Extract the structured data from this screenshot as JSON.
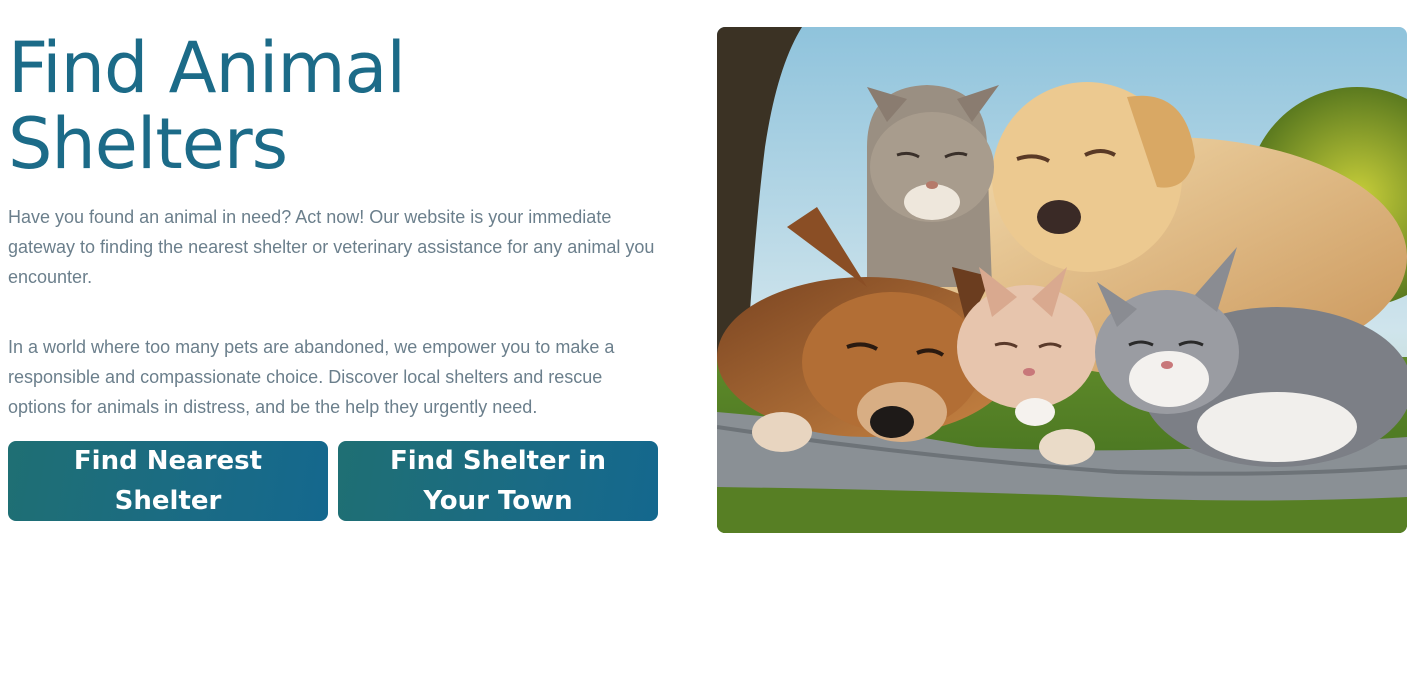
{
  "hero": {
    "title_line1": "Find Animal",
    "title_line2": "Shelters",
    "paragraph1": "Have you found an animal in need? Act now! Our website is your immediate gateway to finding the nearest shelter or veterinary assistance for any animal you encounter.",
    "paragraph2": "In a world where too many pets are abandoned, we empower you to make a responsible and compassionate choice. Discover local shelters and rescue options for animals in distress, and be the help they urgently need.",
    "buttons": {
      "nearest_label": "Find Nearest Shelter",
      "town_label": "Find Shelter in Your Town"
    }
  },
  "image": {
    "subject": "dogs and cats sleeping together on a blanket in the grass"
  },
  "colors": {
    "title": "#1c6b88",
    "body_text": "#6b7f8c",
    "button_start": "#1f6f73",
    "button_end": "#14688e",
    "button_text": "#ffffff"
  }
}
